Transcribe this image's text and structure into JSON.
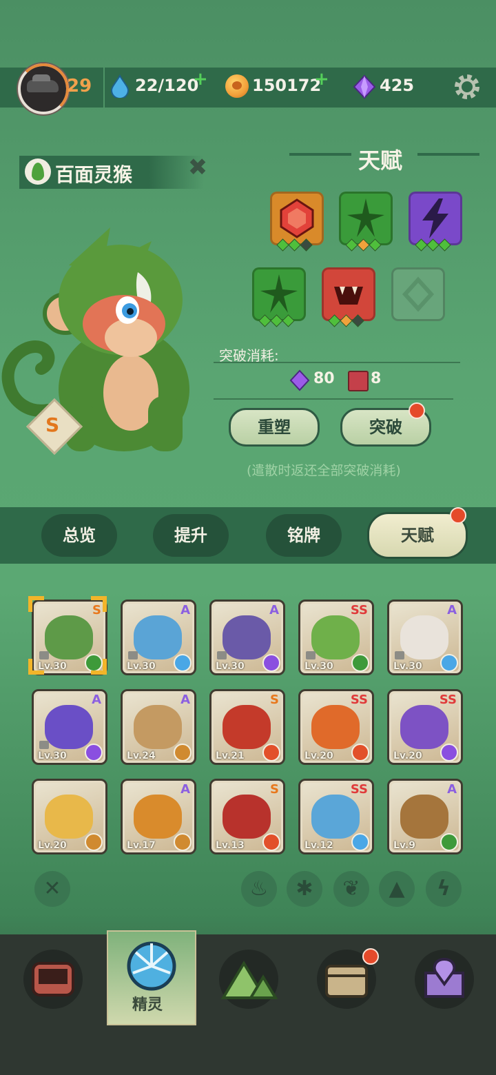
{
  "topbar": {
    "level": "29",
    "energy": "22/120",
    "coins": "150172",
    "gems": "425",
    "icons": [
      "avatar",
      "water-drop-icon",
      "paw-coin-icon",
      "purple-gem-icon",
      "gear-icon",
      "plus-icon"
    ]
  },
  "pet": {
    "name": "百面灵猴",
    "rank": "S",
    "element": "leaf"
  },
  "talent": {
    "title": "天赋",
    "slots": [
      {
        "icon": "ruby-gem-icon",
        "color": "#d98a2a",
        "dots": [
          "g",
          "g",
          "d"
        ]
      },
      {
        "icon": "spiky-seed-icon",
        "color": "#3a9b3a",
        "dots": [
          "g",
          "o",
          "g"
        ]
      },
      {
        "icon": "lightning-icon",
        "color": "#7a49c9",
        "dots": [
          "g",
          "g",
          "g"
        ]
      },
      {
        "icon": "spiky-seed-icon",
        "color": "#3a9b3a",
        "dots": [
          "g",
          "g",
          "g"
        ]
      },
      {
        "icon": "fanged-mouth-icon",
        "color": "#d2463a",
        "dots": [
          "g",
          "o",
          "d"
        ]
      },
      {
        "icon": "empty-slot-icon",
        "color": "#6da77e",
        "dots": []
      }
    ],
    "cost_label": "突破消耗:",
    "cost_gems": "80",
    "cost_books": "8",
    "reset_label": "重塑",
    "break_label": "突破",
    "note": "(遣散时返还全部突破消耗)"
  },
  "tabs": [
    {
      "label": "总览",
      "active": false
    },
    {
      "label": "提升",
      "active": false
    },
    {
      "label": "铭牌",
      "active": false
    },
    {
      "label": "天赋",
      "active": true
    }
  ],
  "roster": [
    {
      "lv": "Lv.30",
      "grade": "S",
      "elem": "leaf",
      "locked": true,
      "selected": true,
      "color": "#5e9a48"
    },
    {
      "lv": "Lv.30",
      "grade": "A",
      "elem": "ice",
      "locked": true,
      "color": "#5aa4d6"
    },
    {
      "lv": "Lv.30",
      "grade": "A",
      "elem": "thunder",
      "locked": true,
      "color": "#6a5aa8"
    },
    {
      "lv": "Lv.30",
      "grade": "SS",
      "elem": "leaf",
      "locked": true,
      "color": "#6fb04a"
    },
    {
      "lv": "Lv.30",
      "grade": "A",
      "elem": "ice",
      "locked": true,
      "color": "#e9e3db"
    },
    {
      "lv": "Lv.30",
      "grade": "A",
      "elem": "thunder",
      "locked": true,
      "color": "#6a4fc6"
    },
    {
      "lv": "Lv.24",
      "grade": "A",
      "elem": "earth",
      "locked": false,
      "color": "#c49a62"
    },
    {
      "lv": "Lv.21",
      "grade": "S",
      "elem": "fire",
      "locked": false,
      "color": "#c43a2a"
    },
    {
      "lv": "Lv.20",
      "grade": "SS",
      "elem": "fire",
      "locked": false,
      "color": "#e06a2a"
    },
    {
      "lv": "Lv.20",
      "grade": "SS",
      "elem": "thunder",
      "locked": false,
      "color": "#7d52c4"
    },
    {
      "lv": "Lv.20",
      "grade": "",
      "elem": "earth",
      "locked": false,
      "color": "#e8b84a"
    },
    {
      "lv": "Lv.17",
      "grade": "A",
      "elem": "earth",
      "locked": false,
      "color": "#d98b2c"
    },
    {
      "lv": "Lv.13",
      "grade": "S",
      "elem": "fire",
      "locked": false,
      "color": "#b8322c"
    },
    {
      "lv": "Lv.12",
      "grade": "SS",
      "elem": "ice",
      "locked": false,
      "color": "#5aa6d8"
    },
    {
      "lv": "Lv.9",
      "grade": "A",
      "elem": "leaf",
      "locked": false,
      "color": "#a5753c"
    }
  ],
  "filters": [
    "clear-filter-icon",
    "fire-icon",
    "ice-icon",
    "leaf-icon",
    "earth-icon",
    "thunder-icon"
  ],
  "nav": {
    "items": [
      "console-icon",
      "spirit-icon",
      "mountain-icon",
      "chest-icon",
      "map-pin-icon"
    ],
    "active_label": "精灵"
  },
  "colors": {
    "accent": "#2f6a49",
    "badge_red": "#e54a2a",
    "gold": "#f0a14c"
  }
}
